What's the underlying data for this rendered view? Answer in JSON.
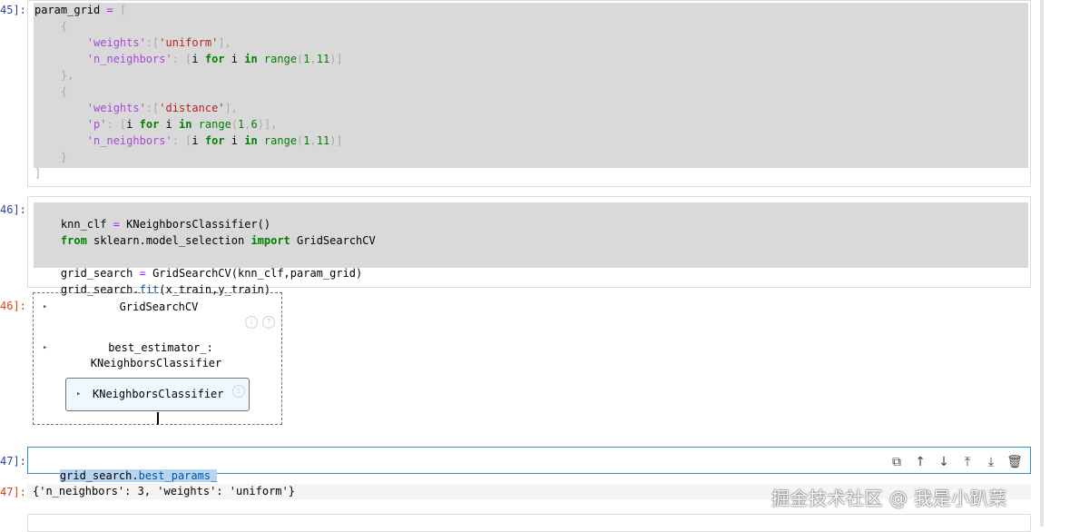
{
  "prompts": {
    "c45": "45]:",
    "c46": "46]:",
    "o46": "46]:",
    "c47": "47]:",
    "o47": "47]:"
  },
  "cell45": {
    "lines": [
      [
        "param_grid ",
        "= ",
        "["
      ],
      [
        "    {"
      ],
      [
        "        'weights'",
        ":[",
        "'uniform'",
        "],"
      ],
      [
        "        'n_neighbors'",
        ": [",
        "i ",
        "for",
        " i ",
        "in",
        " ",
        "range",
        "(",
        "1",
        ",",
        "11",
        ")]"
      ],
      [
        "    },"
      ],
      [
        "    {"
      ],
      [
        "        'weights'",
        ":[",
        "'distance'",
        "],"
      ],
      [
        "        'p'",
        ": [",
        "i ",
        "for",
        " i ",
        "in",
        " ",
        "range",
        "(",
        "1",
        ",",
        "6",
        ")],"
      ],
      [
        "        'n_neighbors'",
        ": [",
        "i ",
        "for",
        " i ",
        "in",
        " ",
        "range",
        "(",
        "1",
        ",",
        "11",
        ")]"
      ],
      [
        "    }"
      ],
      [
        "]"
      ]
    ]
  },
  "cell46": {
    "line1a": "knn_clf ",
    "line1b": "= ",
    "line1c": "KNeighborsClassifier()",
    "line2a": "from",
    "line2b": " sklearn.model_selection ",
    "line2c": "import",
    "line2d": " GridSearchCV",
    "line4a": "grid_search ",
    "line4b": "= ",
    "line4c": "GridSearchCV(knn_clf,param_grid)",
    "line5a": "grid_search.",
    "line5b": "fit",
    "line5c": "(x_train,y_train)"
  },
  "output46": {
    "title": "GridSearchCV",
    "best_line1": "best_estimator_:",
    "best_line2": "KNeighborsClassifier",
    "estimator": "KNeighborsClassifier",
    "info_icon": "i",
    "help_icon": "?",
    "arrow": "▸"
  },
  "cell47": {
    "code_a": "grid_search.",
    "code_b": "best_params_",
    "toolbar": [
      {
        "name": "duplicate-icon",
        "glyph": "⧉"
      },
      {
        "name": "move-up-icon",
        "glyph": "↑"
      },
      {
        "name": "move-down-icon",
        "glyph": "↓"
      },
      {
        "name": "insert-above-icon",
        "glyph": "⤒"
      },
      {
        "name": "insert-below-icon",
        "glyph": "⤓"
      },
      {
        "name": "delete-icon",
        "glyph": "🗑"
      }
    ]
  },
  "output47": {
    "text": "{'n_neighbors': 3, 'weights': 'uniform'}"
  },
  "watermark": "掘金技术社区 @ 我是小趴菜",
  "colors": {
    "prompt": "#303f9f",
    "keyword": "#008000",
    "string": "#ba2121",
    "selection": "#2b8fcf"
  }
}
